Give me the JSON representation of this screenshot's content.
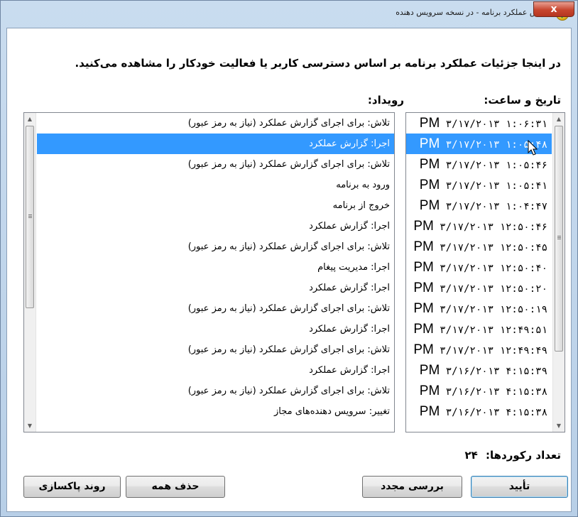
{
  "window": {
    "title": "گزارش عملکرد برنامه - در نسخه سرویس دهنده",
    "close_label": "x"
  },
  "description": "در اینجا جزئیات عملکرد برنامه بر اساس دسترسی کاربر یا فعالیت خودکار را مشاهده می‌کنید.",
  "headers": {
    "date": "تاریخ و ساعت:",
    "event": "رویداد:"
  },
  "rows": [
    {
      "date": "۳/۱۷/۲۰۱۳ ۱:۰۶:۳۱",
      "ampm": "PM",
      "event": "تلاش: برای اجرای گزارش عملکرد (نیاز به رمز عبور)",
      "selected": false
    },
    {
      "date": "۳/۱۷/۲۰۱۳ ۱:۰۵:۴۸",
      "ampm": "PM",
      "event": "اجرا: گزارش عملکرد",
      "selected": true
    },
    {
      "date": "۳/۱۷/۲۰۱۳ ۱:۰۵:۴۶",
      "ampm": "PM",
      "event": "تلاش: برای اجرای گزارش عملکرد (نیاز به رمز عبور)",
      "selected": false
    },
    {
      "date": "۳/۱۷/۲۰۱۳ ۱:۰۵:۴۱",
      "ampm": "PM",
      "event": "ورود به برنامه",
      "selected": false
    },
    {
      "date": "۳/۱۷/۲۰۱۳ ۱:۰۴:۴۷",
      "ampm": "PM",
      "event": "خروج از برنامه",
      "selected": false
    },
    {
      "date": "۳/۱۷/۲۰۱۳ ۱۲:۵۰:۴۶",
      "ampm": "PM",
      "event": "اجرا: گزارش عملکرد",
      "selected": false
    },
    {
      "date": "۳/۱۷/۲۰۱۳ ۱۲:۵۰:۴۵",
      "ampm": "PM",
      "event": "تلاش: برای اجرای گزارش عملکرد (نیاز به رمز عبور)",
      "selected": false
    },
    {
      "date": "۳/۱۷/۲۰۱۳ ۱۲:۵۰:۴۰",
      "ampm": "PM",
      "event": "اجرا: مدیریت پیغام",
      "selected": false
    },
    {
      "date": "۳/۱۷/۲۰۱۳ ۱۲:۵۰:۲۰",
      "ampm": "PM",
      "event": "اجرا: گزارش عملکرد",
      "selected": false
    },
    {
      "date": "۳/۱۷/۲۰۱۳ ۱۲:۵۰:۱۹",
      "ampm": "PM",
      "event": "تلاش: برای اجرای گزارش عملکرد (نیاز به رمز عبور)",
      "selected": false
    },
    {
      "date": "۳/۱۷/۲۰۱۳ ۱۲:۴۹:۵۱",
      "ampm": "PM",
      "event": "اجرا: گزارش عملکرد",
      "selected": false
    },
    {
      "date": "۳/۱۷/۲۰۱۳ ۱۲:۴۹:۴۹",
      "ampm": "PM",
      "event": "تلاش: برای اجرای گزارش عملکرد (نیاز به رمز عبور)",
      "selected": false
    },
    {
      "date": "۳/۱۶/۲۰۱۳ ۴:۱۵:۳۹",
      "ampm": "PM",
      "event": "اجرا: گزارش عملکرد",
      "selected": false
    },
    {
      "date": "۳/۱۶/۲۰۱۳ ۴:۱۵:۳۸",
      "ampm": "PM",
      "event": "تلاش: برای اجرای گزارش عملکرد (نیاز به رمز عبور)",
      "selected": false
    },
    {
      "date": "۳/۱۶/۲۰۱۳ ۴:۱۵:۳۸",
      "ampm": "PM",
      "event": "تغییر: سرویس دهنده‌های مجاز",
      "selected": false
    }
  ],
  "record_count": {
    "label": "تعداد رکوردها:",
    "value": "۲۴"
  },
  "buttons": {
    "ok": "تأیید",
    "recheck": "بررسی مجدد",
    "delete_all": "حذف همه",
    "cleanup": "روند پاکسازی"
  },
  "colors": {
    "selection": "#3399ff",
    "close_button": "#c7462f"
  },
  "icons": {
    "app": "app-check-icon",
    "close": "close-icon",
    "scroll_up": "scroll-up-arrow-icon",
    "scroll_down": "scroll-down-arrow-icon",
    "cursor": "mouse-pointer-icon"
  }
}
